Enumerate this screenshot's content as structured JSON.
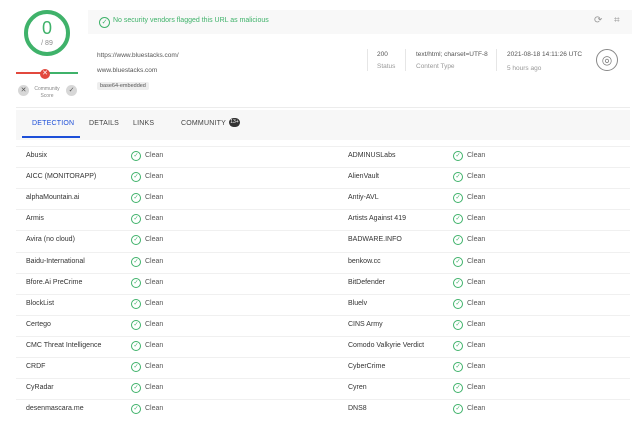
{
  "score": {
    "detections": "0",
    "total": "/ 89",
    "community_label": "Community Score"
  },
  "banner": {
    "message": "No security vendors flagged this URL as malicious"
  },
  "url_info": {
    "url": "https://www.bluestacks.com/",
    "host": "www.bluestacks.com",
    "tag": "base64-embedded",
    "status_value": "200",
    "status_label": "Status",
    "content_type_value": "text/html; charset=UTF-8",
    "content_type_label": "Content Type",
    "date_value": "2021-08-18 14:11:26 UTC",
    "date_ago": "5 hours ago"
  },
  "tabs": {
    "detection": "DETECTION",
    "details": "DETAILS",
    "links": "LINKS",
    "community": "COMMUNITY",
    "community_count": "13+"
  },
  "status_word": "Clean",
  "vendors_left": [
    "Abusix",
    "AICC (MONITORAPP)",
    "alphaMountain.ai",
    "Armis",
    "Avira (no cloud)",
    "Baidu-International",
    "Bfore.Ai PreCrime",
    "BlockList",
    "Certego",
    "CMC Threat Intelligence",
    "CRDF",
    "CyRadar",
    "desenmascara.me"
  ],
  "vendors_right": [
    "ADMINUSLabs",
    "AlienVault",
    "Antiy-AVL",
    "Artists Against 419",
    "BADWARE.INFO",
    "benkow.cc",
    "BitDefender",
    "Bluelv",
    "CINS Army",
    "Comodo Valkyrie Verdict",
    "CyberCrime",
    "Cyren",
    "DNS8"
  ],
  "colors": {
    "clean": "#3fb26a",
    "malicious": "#e2483d",
    "active_tab": "#1d4fd8"
  },
  "icons": {
    "refresh": "refresh-icon",
    "qr": "qr-icon",
    "globe": "globe-icon"
  }
}
